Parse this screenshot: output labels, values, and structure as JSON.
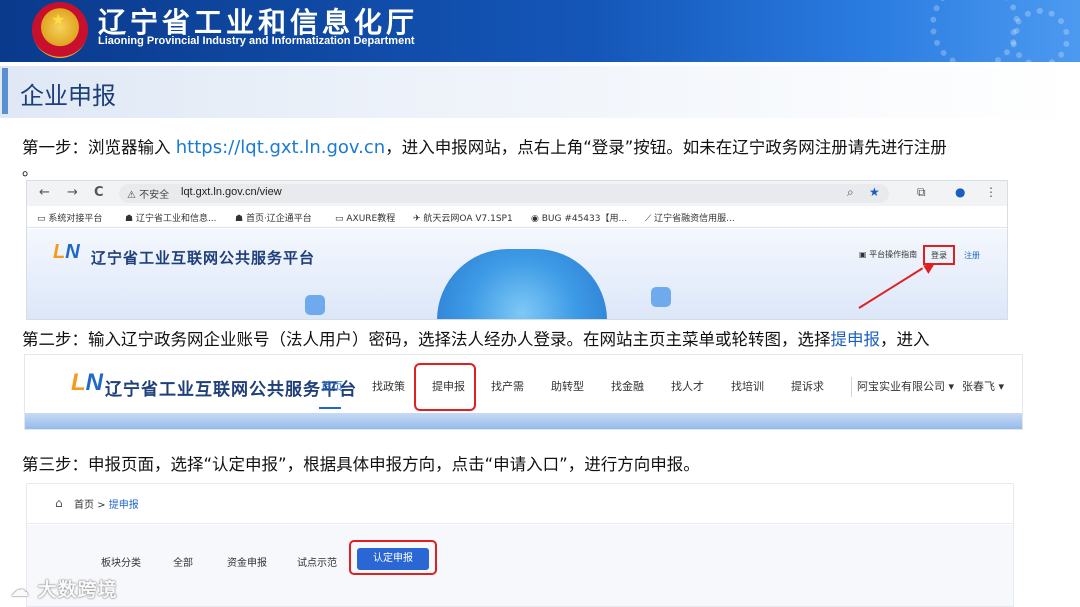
{
  "header": {
    "title": "辽宁省工业和信息化厅",
    "subtitle": "Liaoning Provincial Industry and Informatization Department"
  },
  "section": {
    "title": "企业申报"
  },
  "step1": {
    "prefix": "第一步：浏览器输入 ",
    "url": "https://lqt.gxt.ln.gov.cn",
    "suffix": "，进入申报网站，点右上角“登录”按钮。如未在辽宁政务网注册请先进行注册",
    "dot": "。"
  },
  "browser": {
    "back": "←",
    "forward": "→",
    "reload": "C",
    "insecure": "⚠ 不安全",
    "address": "lqt.gxt.ln.gov.cn/view",
    "bookmarks": [
      "系统对接平台",
      "辽宁省工业和信息...",
      "首页·辽企通平台",
      "AXURE教程",
      "航天云网OA V7.1SP1",
      "BUG #45433【用...",
      "辽宁省融资信用服..."
    ]
  },
  "site1": {
    "logo": "LN",
    "title": "辽宁省工业互联网公共服务平台",
    "guide": "平台操作指南",
    "login": "登录",
    "register": "注册"
  },
  "step2": {
    "prefix": "第二步：输入辽宁政务网企业账号（法人用户）密码，选择法人经办人登录。在网站主页主菜单或轮转图，选择",
    "highlight": "提申报",
    "suffix": "，进入"
  },
  "site2": {
    "logo": "LN",
    "title": "辽宁省工业互联网公共服务平台",
    "nav": [
      "首页",
      "找政策",
      "提申报",
      "找产需",
      "助转型",
      "找金融",
      "找人才",
      "找培训",
      "提诉求"
    ],
    "company": "阿宝实业有限公司 ▾",
    "user": "张春飞 ▾"
  },
  "step3": {
    "text": "第三步：申报页面，选择“认定申报”，根据具体申报方向，点击“申请入口”，进行方向申报。"
  },
  "site3": {
    "breadcrumb_home": "首页",
    "breadcrumb_sep": " > ",
    "breadcrumb_current": "提申报",
    "tabs": [
      "板块分类",
      "全部",
      "资金申报",
      "试点示范"
    ],
    "active_tab": "认定申报"
  },
  "watermark": {
    "text": "大数跨境"
  },
  "colors": {
    "banner": "#1456b8",
    "highlight": "#1f67c9",
    "annotation": "#e02020"
  }
}
